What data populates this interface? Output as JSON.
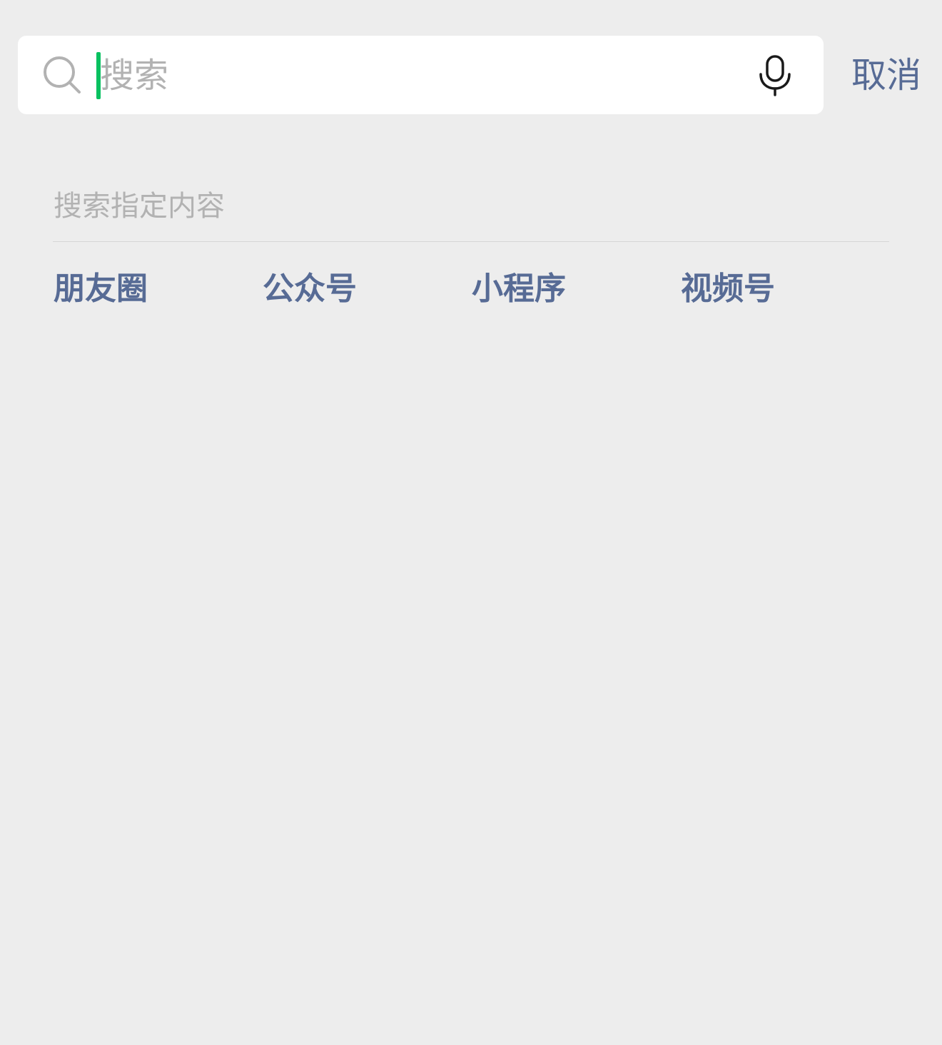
{
  "search": {
    "placeholder": "搜索",
    "value": "",
    "icon": "search-icon",
    "voice_icon": "microphone-icon",
    "cursor_color": "#07c160"
  },
  "cancel_label": "取消",
  "section": {
    "title": "搜索指定内容",
    "categories": [
      {
        "label": "朋友圈"
      },
      {
        "label": "公众号"
      },
      {
        "label": "小程序"
      },
      {
        "label": "视频号"
      }
    ]
  },
  "colors": {
    "background": "#ededed",
    "link": "#576b95",
    "placeholder": "#b2b2b2",
    "accent": "#07c160"
  }
}
